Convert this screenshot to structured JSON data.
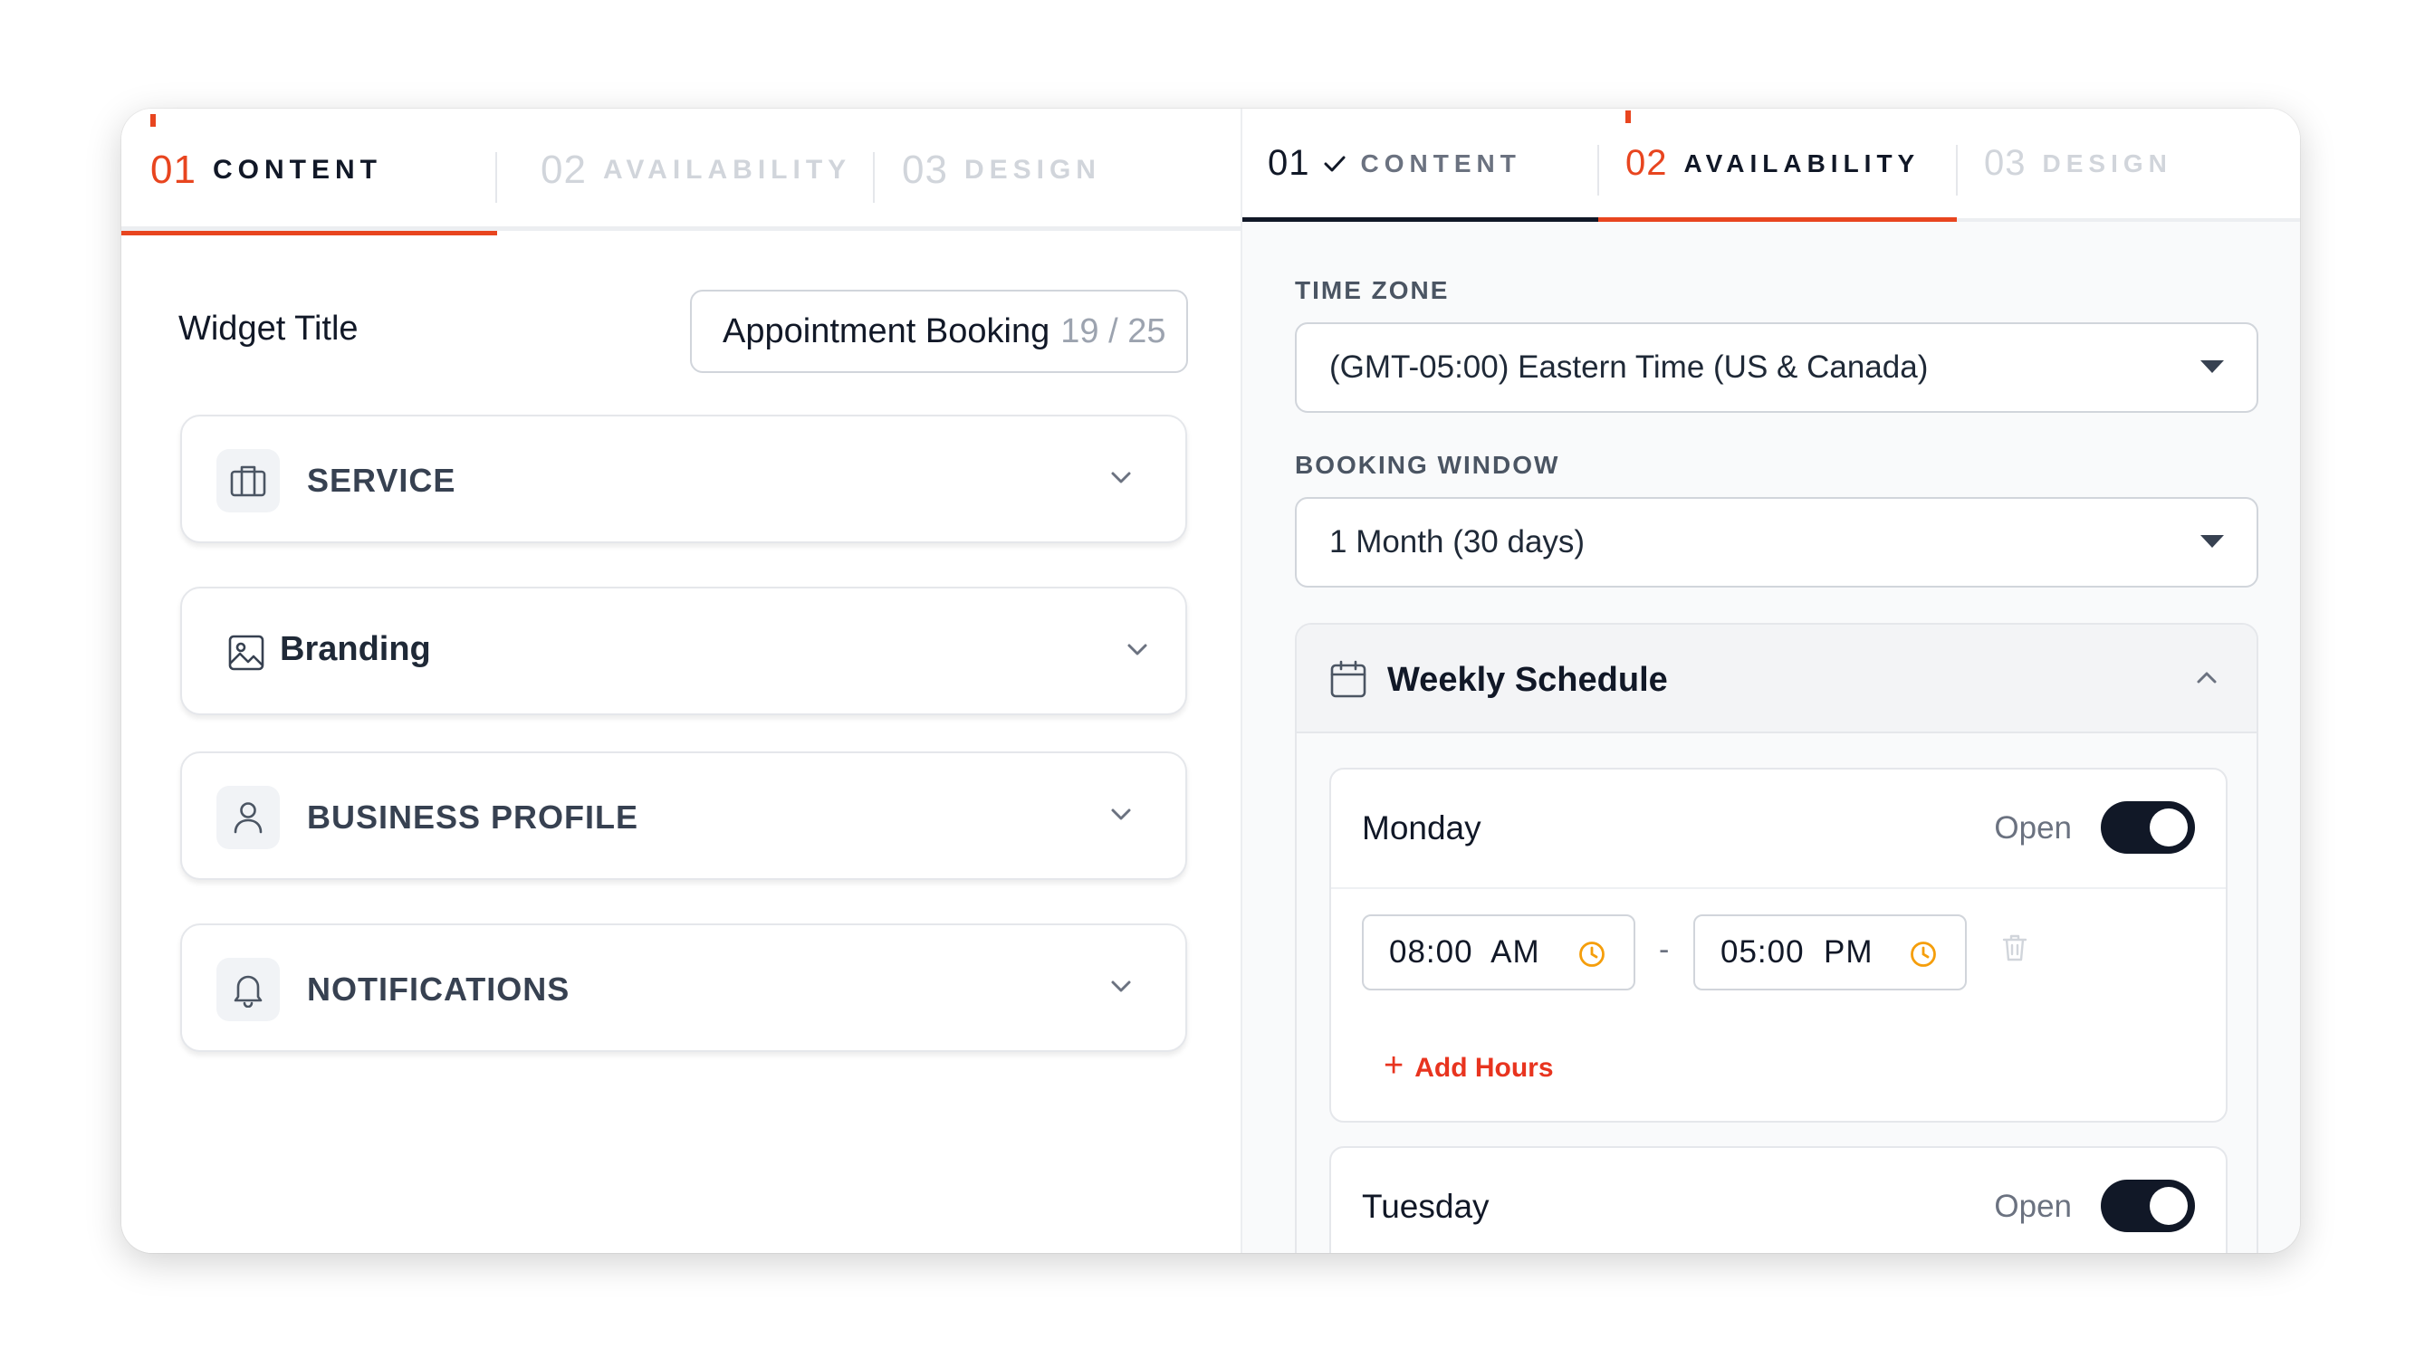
{
  "left": {
    "tabs": [
      {
        "num": "01",
        "label": "CONTENT",
        "state": "active"
      },
      {
        "num": "02",
        "label": "AVAILABILITY",
        "state": "inactive"
      },
      {
        "num": "03",
        "label": "DESIGN",
        "state": "inactive"
      }
    ],
    "widget_title": {
      "label": "Widget Title",
      "value": "Appointment Booking",
      "counter": "19 / 25"
    },
    "accordions": [
      {
        "label": "SERVICE",
        "icon": "briefcase-icon"
      },
      {
        "label": "Branding",
        "icon": "image-icon"
      },
      {
        "label": "BUSINESS PROFILE",
        "icon": "user-icon"
      },
      {
        "label": "NOTIFICATIONS",
        "icon": "bell-icon"
      }
    ]
  },
  "right": {
    "tabs": [
      {
        "num": "01",
        "label": "CONTENT",
        "state": "done",
        "icon": "check-icon"
      },
      {
        "num": "02",
        "label": "AVAILABILITY",
        "state": "active"
      },
      {
        "num": "03",
        "label": "DESIGN",
        "state": "inactive"
      }
    ],
    "time_zone": {
      "label": "TIME ZONE",
      "value": "(GMT-05:00) Eastern Time (US & Canada)"
    },
    "booking_window": {
      "label": "BOOKING WINDOW",
      "value": "1 Month (30 days)"
    },
    "weekly_schedule": {
      "title": "Weekly Schedule",
      "days": [
        {
          "name": "Monday",
          "status": "Open",
          "enabled": true,
          "start": "08:00  AM",
          "end": "05:00  PM",
          "add_label": "Add Hours"
        },
        {
          "name": "Tuesday",
          "status": "Open",
          "enabled": true
        }
      ]
    }
  },
  "colors": {
    "accent": "#e8451f",
    "toggle_on": "#111827",
    "inactive_text": "#d1d5db"
  }
}
